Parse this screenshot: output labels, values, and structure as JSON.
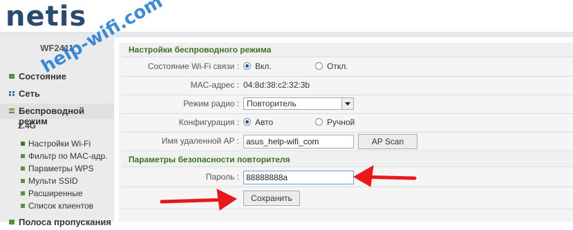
{
  "brand": {
    "logo_text": "netis"
  },
  "watermark": "help-wifi.com",
  "sidebar": {
    "model": "WF2411",
    "nav": [
      {
        "label": "Состояние",
        "icon": "status-icon"
      },
      {
        "label": "Сеть",
        "icon": "network-icon"
      },
      {
        "label": "Беспроводной режим",
        "icon": "wireless-icon"
      }
    ],
    "band": "2.4G",
    "subitems": [
      "Настройки Wi-Fi",
      "Фильтр по MAC-адр.",
      "Параметры WPS",
      "Мульти SSID",
      "Расширенные",
      "Список клиентов"
    ],
    "next_nav": "Полоса пропускания"
  },
  "main": {
    "section1_title": "Настройки беспроводного режима",
    "wifi_status": {
      "label": "Состояние Wi-Fi связи :",
      "opt_on": "Вкл.",
      "opt_off": "Откл.",
      "selected": "Вкл."
    },
    "mac": {
      "label": "MAC-адрес :",
      "value": "04:8d:38:c2:32:3b"
    },
    "radio_mode": {
      "label": "Режим радио :",
      "value": "Повторитель"
    },
    "config": {
      "label": "Конфигурация :",
      "opt_auto": "Авто",
      "opt_manual": "Ручной",
      "selected": "Авто"
    },
    "remote_ap": {
      "label": "Имя удаленной AP :",
      "value": "asus_help-wifi_com",
      "scan_button": "AP Scan"
    },
    "section2_title": "Параметры безопасности повторителя",
    "password": {
      "label": "Пароль :",
      "value": "88888888a"
    },
    "save_button": "Сохранить"
  },
  "colors": {
    "accent_green": "#3e6f2a",
    "logo_blue": "#2b4a6f",
    "arrow_red": "#e8191c",
    "watermark_blue": "#1f77d0"
  }
}
